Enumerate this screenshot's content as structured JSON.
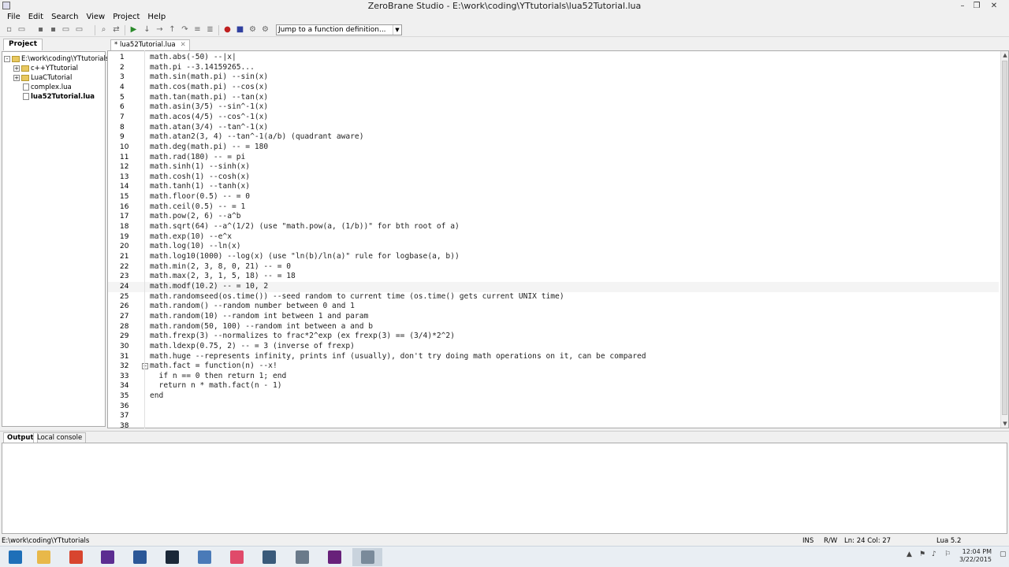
{
  "window": {
    "title": "ZeroBrane Studio - E:\\work\\coding\\YTtutorials\\lua52Tutorial.lua",
    "controls": [
      "–",
      "❐",
      "✕"
    ]
  },
  "menu": [
    "File",
    "Edit",
    "Search",
    "View",
    "Project",
    "Help"
  ],
  "toolbar": {
    "function_dropdown": "Jump to a function definition...",
    "icons": [
      "new-file-icon",
      "open-file-icon",
      "save-icon",
      "save-all-icon",
      "project-dir-icon",
      "find-icon",
      "replace-icon",
      "run-icon",
      "step-into-icon",
      "step-over-icon",
      "step-out-icon",
      "run-to-cursor-icon",
      "stack-window-icon",
      "watch-window-icon",
      "toggle-breakpoint-icon",
      "stop-icon",
      "break-icon",
      "compile-icon",
      "analyze-icon"
    ]
  },
  "project": {
    "tab_label": "Project",
    "tree": [
      {
        "label": "E:\\work\\coding\\YTtutorials",
        "type": "folder",
        "toggle": "-",
        "level": 0
      },
      {
        "label": "c++YTtutorial",
        "type": "folder",
        "toggle": "+",
        "level": 1
      },
      {
        "label": "LuaCTutorial",
        "type": "folder",
        "toggle": "+",
        "level": 1
      },
      {
        "label": "complex.lua",
        "type": "file",
        "level": 1
      },
      {
        "label": "lua52Tutorial.lua",
        "type": "file",
        "level": 1,
        "bold": true
      }
    ]
  },
  "editor": {
    "tab_label": "* lua52Tutorial.lua",
    "tab_close": "✕",
    "current_line": 24,
    "lines": [
      {
        "n": "1",
        "code": "math.abs(-50) --|x|"
      },
      {
        "n": "2",
        "code": "math.pi --3.14159265..."
      },
      {
        "n": "3",
        "code": "math.sin(math.pi) --sin(x)"
      },
      {
        "n": "4",
        "code": "math.cos(math.pi) --cos(x)"
      },
      {
        "n": "5",
        "code": "math.tan(math.pi) --tan(x)"
      },
      {
        "n": "6",
        "code": "math.asin(3/5) --sin^-1(x)"
      },
      {
        "n": "7",
        "code": "math.acos(4/5) --cos^-1(x)"
      },
      {
        "n": "8",
        "code": "math.atan(3/4) --tan^-1(x)"
      },
      {
        "n": "9",
        "code": "math.atan2(3, 4) --tan^-1(a/b) (quadrant aware)"
      },
      {
        "n": "10",
        "code": "math.deg(math.pi) -- = 180"
      },
      {
        "n": "11",
        "code": "math.rad(180) -- = pi"
      },
      {
        "n": "12",
        "code": "math.sinh(1) --sinh(x)"
      },
      {
        "n": "13",
        "code": "math.cosh(1) --cosh(x)"
      },
      {
        "n": "14",
        "code": "math.tanh(1) --tanh(x)"
      },
      {
        "n": "15",
        "code": "math.floor(0.5) -- = 0"
      },
      {
        "n": "16",
        "code": "math.ceil(0.5) -- = 1"
      },
      {
        "n": "17",
        "code": "math.pow(2, 6) --a^b"
      },
      {
        "n": "18",
        "code": "math.sqrt(64) --a^(1/2) (use \"math.pow(a, (1/b))\" for bth root of a)"
      },
      {
        "n": "19",
        "code": "math.exp(10) --e^x"
      },
      {
        "n": "20",
        "code": "math.log(10) --ln(x)"
      },
      {
        "n": "21",
        "code": "math.log10(1000) --log(x) (use \"ln(b)/ln(a)\" rule for logbase(a, b))"
      },
      {
        "n": "22",
        "code": "math.min(2, 3, 8, 0, 21) -- = 0"
      },
      {
        "n": "23",
        "code": "math.max(2, 3, 1, 5, 18) -- = 18"
      },
      {
        "n": "24",
        "code": "math.modf(10.2) -- = 10, 2"
      },
      {
        "n": "25",
        "code": "math.randomseed(os.time()) --seed random to current time (os.time() gets current UNIX time)"
      },
      {
        "n": "26",
        "code": "math.random() --random number between 0 and 1"
      },
      {
        "n": "27",
        "code": "math.random(10) --random int between 1 and param"
      },
      {
        "n": "28",
        "code": "math.random(50, 100) --random int between a and b"
      },
      {
        "n": "29",
        "code": "math.frexp(3) --normalizes to frac*2^exp (ex frexp(3) == (3/4)*2^2)"
      },
      {
        "n": "30",
        "code": "math.ldexp(0.75, 2) -- = 3 (inverse of frexp)"
      },
      {
        "n": "31",
        "code": "math.huge --represents infinity, prints inf (usually), don't try doing math operations on it, can be compared"
      },
      {
        "n": "32",
        "code": "math.fact = function(n) --x!",
        "fold": "−"
      },
      {
        "n": "33",
        "code": "  if n == 0 then return 1; end"
      },
      {
        "n": "34",
        "code": "  return n * math.fact(n - 1)"
      },
      {
        "n": "35",
        "code": "end"
      },
      {
        "n": "36",
        "code": ""
      },
      {
        "n": "37",
        "code": ""
      },
      {
        "n": "38",
        "code": ""
      }
    ]
  },
  "output": {
    "tabs": [
      "Output",
      "Local console"
    ]
  },
  "status": {
    "path": "E:\\work\\coding\\YTtutorials",
    "ins": "INS",
    "rw": "R/W",
    "position": "Ln: 24 Col: 27",
    "language": "Lua 5.2"
  },
  "taskbar": {
    "apps": [
      {
        "name": "windows-start-icon",
        "color": "#1e6fb8"
      },
      {
        "name": "file-explorer-icon",
        "color": "#e8b84a"
      },
      {
        "name": "chrome-icon",
        "color": "#d8452f"
      },
      {
        "name": "visual-studio-icon",
        "color": "#5c2d91"
      },
      {
        "name": "word-icon",
        "color": "#2b5797"
      },
      {
        "name": "steam-icon",
        "color": "#1b2838"
      },
      {
        "name": "calculator-icon",
        "color": "#4a7ab8"
      },
      {
        "name": "itunes-icon",
        "color": "#e04a6a"
      },
      {
        "name": "app-icon",
        "color": "#3a5a7a"
      },
      {
        "name": "explorer-window-icon",
        "color": "#6a7a8a"
      },
      {
        "name": "visual-studio-2-icon",
        "color": "#68217a"
      },
      {
        "name": "zerobrane-icon",
        "color": "#7a8a9a"
      }
    ],
    "time": "12:04 PM",
    "date": "3/22/2015"
  }
}
